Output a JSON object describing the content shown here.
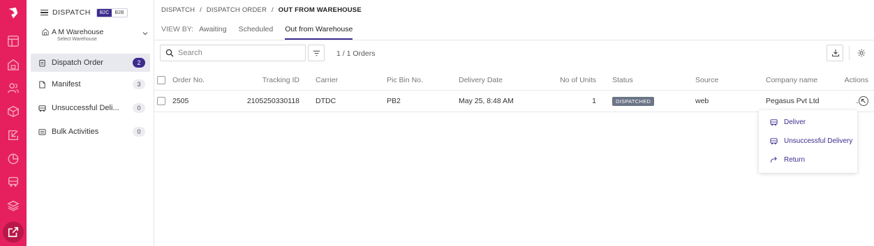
{
  "sidebar": {
    "title": "DISPATCH",
    "toggles": [
      "B2C",
      "B2B"
    ],
    "active_toggle": "B2C",
    "warehouse": {
      "name": "A M Warehouse",
      "sublabel": "Select Warehouse"
    },
    "items": [
      {
        "label": "Dispatch Order",
        "count": "2",
        "icon": "clipboard-icon",
        "active": true
      },
      {
        "label": "Manifest",
        "count": "3",
        "icon": "document-icon",
        "active": false
      },
      {
        "label": "Unsuccessful Deli...",
        "count": "0",
        "icon": "truck-icon",
        "active": false
      },
      {
        "label": "Bulk Activities",
        "count": "0",
        "icon": "stack-icon",
        "active": false
      }
    ]
  },
  "header": {
    "breadcrumb": [
      "DISPATCH",
      "DISPATCH ORDER",
      "OUT FROM WAREHOUSE"
    ],
    "separator": "/",
    "view_by_label": "VIEW BY:",
    "tabs": [
      {
        "label": "Awaiting",
        "active": false
      },
      {
        "label": "Scheduled",
        "active": false
      },
      {
        "label": "Out from Warehouse",
        "active": true
      }
    ]
  },
  "toolbar": {
    "search_placeholder": "Search",
    "orders_count": "1 / 1 Orders"
  },
  "table": {
    "columns": [
      "Order No.",
      "Tracking ID",
      "Carrier",
      "Pic Bin No.",
      "Delivery Date",
      "No of Units",
      "Status",
      "Source",
      "Company name",
      "Actions"
    ],
    "rows": [
      {
        "order_no": "2505",
        "tracking_id": "2105250330118",
        "carrier": "DTDC",
        "pic_bin_no": "PB2",
        "delivery_date": "May 25, 8:48 AM",
        "units": "1",
        "status": "DISPATCHED",
        "source": "web",
        "company": "Pegasus Pvt Ltd"
      }
    ]
  },
  "actions_menu": [
    {
      "label": "Deliver",
      "icon": "truck-icon"
    },
    {
      "label": "Unsuccessful Delivery",
      "icon": "truck-icon"
    },
    {
      "label": "Return",
      "icon": "return-arrow-icon"
    }
  ],
  "colors": {
    "rail": "#e6205f",
    "accent": "#3d2c8d",
    "status_badge": "#6b7587"
  }
}
